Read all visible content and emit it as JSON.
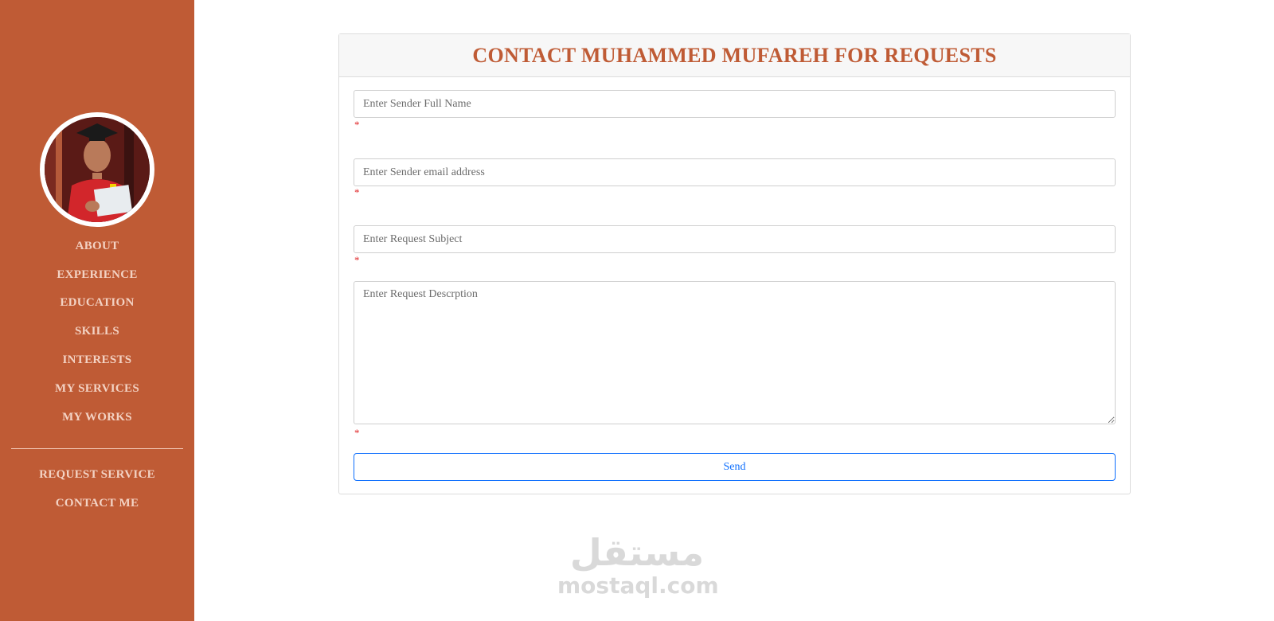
{
  "sidebar": {
    "nav_items": [
      {
        "label": "ABOUT"
      },
      {
        "label": "EXPERIENCE"
      },
      {
        "label": "EDUCATION"
      },
      {
        "label": "SKILLS"
      },
      {
        "label": "INTERESTS"
      },
      {
        "label": "MY SERVICES"
      },
      {
        "label": "MY WORKS"
      }
    ],
    "secondary_items": [
      {
        "label": "REQUEST SERVICE"
      },
      {
        "label": "CONTACT ME"
      }
    ]
  },
  "form": {
    "title": "CONTACT MUHAMMED MUFAREH FOR REQUESTS",
    "name_placeholder": "Enter Sender Full Name",
    "email_placeholder": "Enter Sender email address",
    "subject_placeholder": "Enter Request Subject",
    "description_placeholder": "Enter Request Descrption",
    "required_marker": "*",
    "send_label": "Send"
  },
  "watermark": {
    "arabic": "مستقل",
    "latin": "mostaql.com"
  },
  "colors": {
    "sidebar_bg": "#bf5b35",
    "accent": "#bf5b35",
    "button_blue": "#0d6efd",
    "required_red": "#e0292b"
  }
}
